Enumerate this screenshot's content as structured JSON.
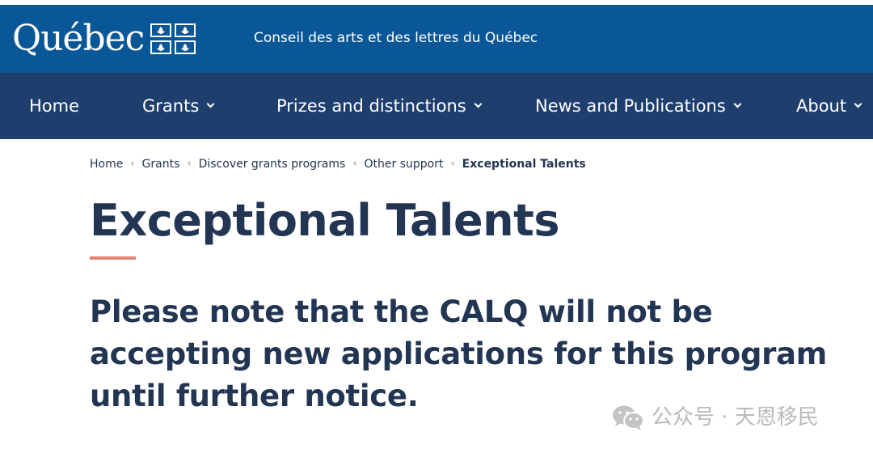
{
  "header": {
    "logo_text": "Québec",
    "org_name": "Conseil des arts et des lettres du Québec",
    "colors": {
      "header_bg": "#095797",
      "nav_bg": "#1e3f6e",
      "text_dark": "#223654",
      "accent": "#e58271"
    }
  },
  "nav": {
    "items": [
      {
        "label": "Home",
        "has_dropdown": false
      },
      {
        "label": "Grants",
        "has_dropdown": true
      },
      {
        "label": "Prizes and distinctions",
        "has_dropdown": true
      },
      {
        "label": "News and Publications",
        "has_dropdown": true
      },
      {
        "label": "About",
        "has_dropdown": true
      }
    ]
  },
  "breadcrumb": {
    "items": [
      {
        "label": "Home"
      },
      {
        "label": "Grants"
      },
      {
        "label": "Discover grants programs"
      },
      {
        "label": "Other support"
      },
      {
        "label": "Exceptional Talents",
        "current": true
      }
    ],
    "separator": "‹"
  },
  "main": {
    "title": "Exceptional Talents",
    "notice": "Please note that the CALQ will not be accepting new applications for this program until further notice."
  },
  "watermark": {
    "icon": "wechat-icon",
    "text": "公众号 · 天恩移民"
  }
}
